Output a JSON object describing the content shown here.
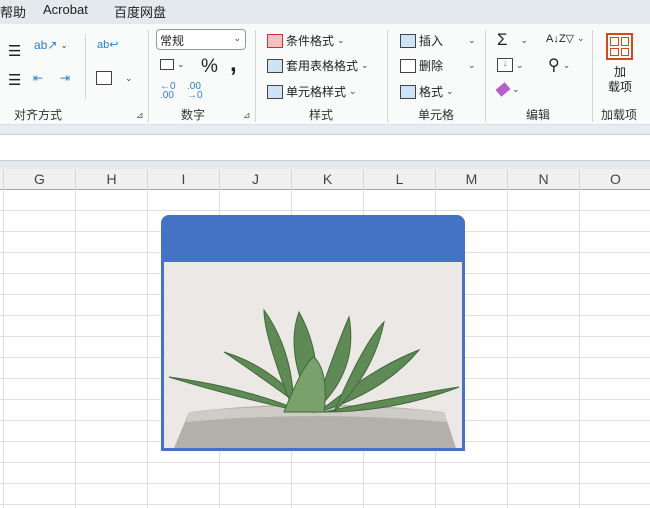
{
  "tabs": [
    "帮助",
    "Acrobat",
    "百度网盘"
  ],
  "ribbon": {
    "alignment": {
      "label": "对齐方式"
    },
    "number": {
      "label": "数字",
      "format_value": "常规",
      "percent": "%",
      "comma": ","
    },
    "styles": {
      "label": "样式",
      "conditional": "条件格式",
      "table": "套用表格格式",
      "cell": "单元格样式"
    },
    "cells": {
      "label": "单元格",
      "insert": "插入",
      "delete": "删除",
      "format": "格式"
    },
    "editing": {
      "label": "编辑"
    },
    "addins": {
      "label": "加载项",
      "button": "加\n载项"
    }
  },
  "columns": [
    "G",
    "H",
    "I",
    "J",
    "K",
    "L",
    "M",
    "N",
    "O"
  ],
  "colors": {
    "accent": "#4472c4",
    "addin": "#d04a1c"
  }
}
